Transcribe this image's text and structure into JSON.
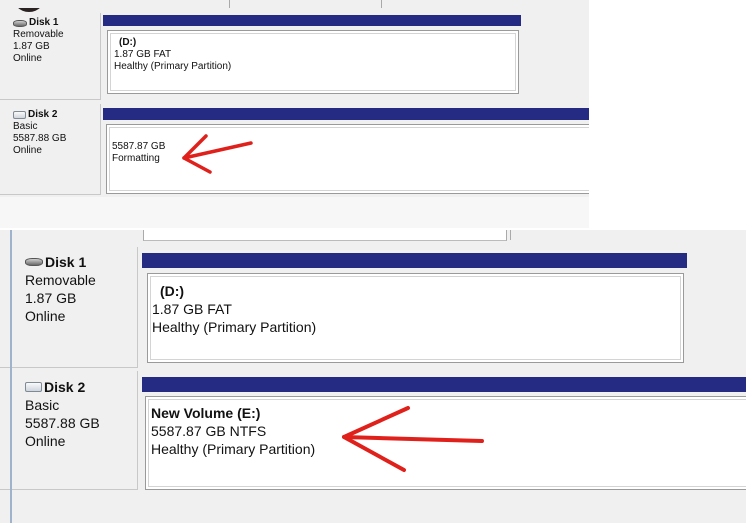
{
  "disks": [
    {
      "name": "Disk 1",
      "type": "Removable",
      "size": "1.87 GB",
      "status": "Online",
      "partition": {
        "label": "(D:)",
        "detail": "1.87 GB FAT",
        "health": "Healthy (Primary Partition)"
      }
    },
    {
      "name": "Disk 2",
      "type": "Basic",
      "size": "5587.88 GB",
      "status": "Online"
    }
  ],
  "before": {
    "disk2_partition": {
      "size": "5587.87 GB",
      "status": "Formatting"
    }
  },
  "after": {
    "disk2_partition": {
      "label": "New Volume  (E:)",
      "detail": "5587.87 GB NTFS",
      "health": "Healthy (Primary Partition)"
    }
  },
  "colors": {
    "partition_header": "#252a82",
    "panel_bg": "#f0f0f0",
    "arrow": "#e0201a"
  },
  "icons": {
    "removable": "removable-drive-icon",
    "basic": "basic-disk-icon",
    "annotation": "red-arrow-annotation"
  }
}
